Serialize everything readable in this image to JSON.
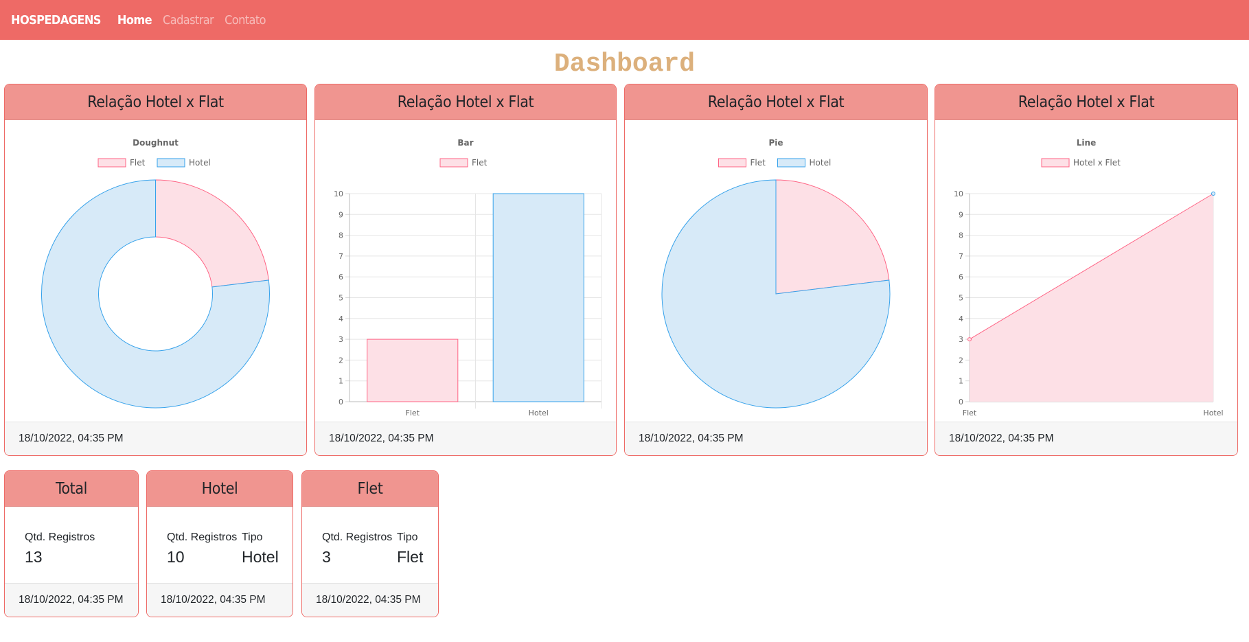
{
  "nav": {
    "brand": "HOSPEDAGENS",
    "links": [
      {
        "label": "Home",
        "active": true
      },
      {
        "label": "Cadastrar",
        "active": false
      },
      {
        "label": "Contato",
        "active": false
      }
    ]
  },
  "page_title": "Dashboard",
  "colors": {
    "navbar": "#ee6a66",
    "card_header": "#f09590",
    "title": "#dcb07c",
    "flet_fill": "#fde0e6",
    "flet_border": "#ff6384",
    "hotel_fill": "#d7eaf8",
    "hotel_border": "#36a2eb"
  },
  "chart_cards": [
    {
      "header": "Relação Hotel x Flat",
      "footer": "18/10/2022, 04:35 PM"
    },
    {
      "header": "Relação Hotel x Flat",
      "footer": "18/10/2022, 04:35 PM"
    },
    {
      "header": "Relação Hotel x Flat",
      "footer": "18/10/2022, 04:35 PM"
    },
    {
      "header": "Relação Hotel x Flat",
      "footer": "18/10/2022, 04:35 PM"
    }
  ],
  "chart_data": [
    {
      "type": "doughnut",
      "title": "Doughnut",
      "categories": [
        "Flet",
        "Hotel"
      ],
      "values": [
        3,
        10
      ],
      "legend": [
        "Flet",
        "Hotel"
      ],
      "legend_position": "top"
    },
    {
      "type": "bar",
      "title": "Bar",
      "categories": [
        "Flet",
        "Hotel"
      ],
      "series": [
        {
          "name": "Flet",
          "values": [
            3,
            10
          ]
        }
      ],
      "yticks": [
        "0",
        "1",
        "2",
        "3",
        "4",
        "5",
        "6",
        "7",
        "8",
        "9",
        "10"
      ],
      "ylim": [
        0,
        10
      ],
      "grid": true,
      "legend_position": "top"
    },
    {
      "type": "pie",
      "title": "Pie",
      "categories": [
        "Flet",
        "Hotel"
      ],
      "values": [
        3,
        10
      ],
      "legend": [
        "Flet",
        "Hotel"
      ],
      "legend_position": "top"
    },
    {
      "type": "area",
      "title": "Line",
      "categories": [
        "Flet",
        "Hotel"
      ],
      "series": [
        {
          "name": "Hotel x Flet",
          "values": [
            3,
            10
          ]
        }
      ],
      "yticks": [
        "0",
        "1",
        "2",
        "3",
        "4",
        "5",
        "6",
        "7",
        "8",
        "9",
        "10"
      ],
      "ylim": [
        0,
        10
      ],
      "grid": true,
      "legend_position": "top"
    }
  ],
  "stat_cards": [
    {
      "header": "Total",
      "label1": "Qtd. Registros",
      "value1": "13",
      "footer": "18/10/2022, 04:35 PM"
    },
    {
      "header": "Hotel",
      "label1": "Qtd. Registros",
      "value1": "10",
      "label2": "Tipo",
      "value2": "Hotel",
      "footer": "18/10/2022, 04:35 PM"
    },
    {
      "header": "Flet",
      "label1": "Qtd. Registros",
      "value1": "3",
      "label2": "Tipo",
      "value2": "Flet",
      "footer": "18/10/2022, 04:35 PM"
    }
  ]
}
